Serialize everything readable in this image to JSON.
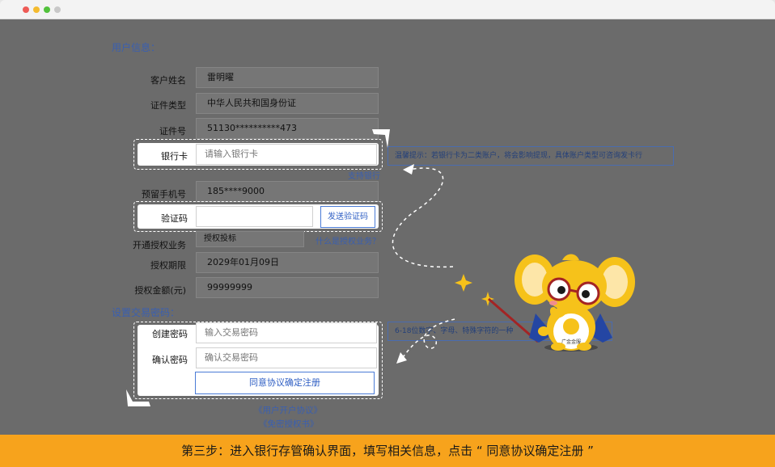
{
  "window": {
    "controls": [
      {
        "name": "close",
        "color": "#ee5b56"
      },
      {
        "name": "minimize",
        "color": "#f4bb2f"
      },
      {
        "name": "maximize",
        "color": "#52c23c"
      },
      {
        "name": "extra",
        "color": "#c8c8c8"
      }
    ]
  },
  "user_info": {
    "section_title": "用户信息：",
    "name_label": "客户姓名",
    "name_value": "雷明曜",
    "id_type_label": "证件类型",
    "id_type_value": "中华人民共和国身份证",
    "id_no_label": "证件号",
    "id_no_value": "51130**********473",
    "bank_card_label": "银行卡",
    "bank_card_placeholder": "请输入银行卡",
    "bank_tip": "温馨提示：若银行卡为二类账户，将会影响提现，具体账户类型可咨询发卡行",
    "supported_banks_link": "支持银行",
    "phone_label": "预留手机号",
    "phone_value": "185****9000",
    "code_label": "验证码",
    "code_value": "",
    "send_code_button": "发送验证码",
    "auth_service_label": "开通授权业务",
    "auth_service_value": "授权投标",
    "what_is_auth_link": "什么是授权业务？",
    "auth_period_label": "授权期限",
    "auth_period_value": "2029年01月09日",
    "auth_amount_label": "授权金额(元)",
    "auth_amount_value": "99999999"
  },
  "password": {
    "section_title": "设置交易密码：",
    "create_label": "创建密码",
    "create_placeholder": "输入交易密码",
    "confirm_label": "确认密码",
    "confirm_placeholder": "确认交易密码",
    "password_tip": "6-18位数字、字母、特殊字符的一种",
    "agree_button": "同意协议确定注册",
    "agreement_link": "《用户开户协议》",
    "disclaimer_link": "《免密授权书》"
  },
  "mascot": {
    "badge_text": "广金金服"
  },
  "footer": {
    "instruction": "第三步：进入银行存管确认界面，填写相关信息，点击 “ 同意协议确定注册 ”"
  }
}
